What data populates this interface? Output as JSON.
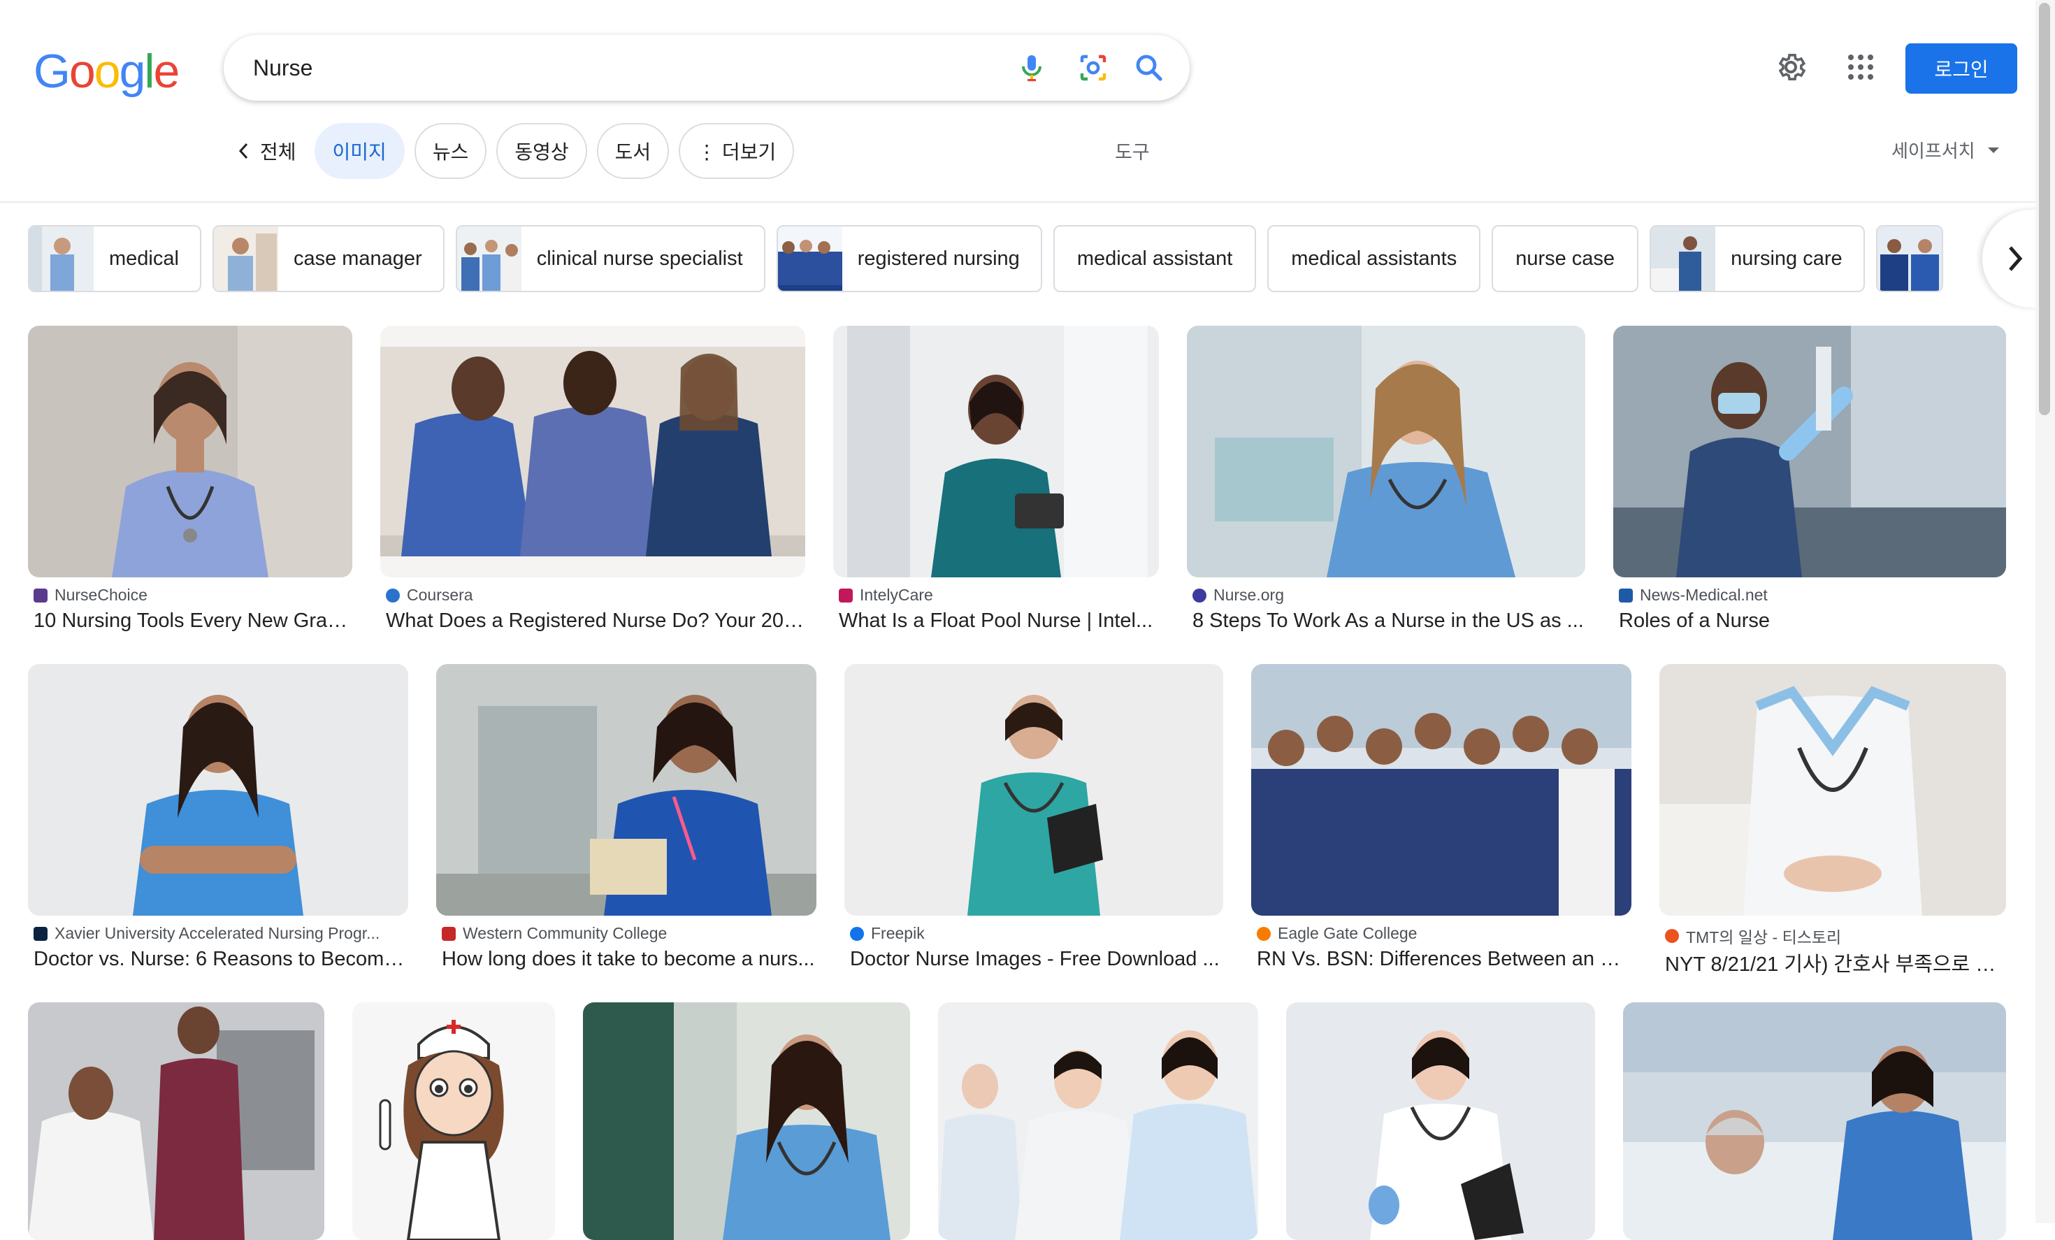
{
  "logo": {
    "letters": [
      "G",
      "o",
      "o",
      "g",
      "l",
      "e"
    ],
    "colors": [
      "#4285F4",
      "#EA4335",
      "#FBBC05",
      "#4285F4",
      "#34A853",
      "#EA4335"
    ]
  },
  "search": {
    "query": "Nurse",
    "icons": [
      "mic-icon",
      "lens-icon",
      "search-icon"
    ]
  },
  "header": {
    "login_label": "로그인",
    "icons": [
      "settings-gear-icon",
      "apps-grid-icon"
    ]
  },
  "tabs": {
    "back_label": "전체",
    "items": [
      {
        "label": "이미지",
        "active": true
      },
      {
        "label": "뉴스"
      },
      {
        "label": "동영상"
      },
      {
        "label": "도서"
      },
      {
        "label": "⋮ 더보기"
      }
    ],
    "tools_label": "도구",
    "safesearch_label": "세이프서치"
  },
  "chips": [
    {
      "label": "medical"
    },
    {
      "label": "case manager"
    },
    {
      "label": "clinical nurse specialist"
    },
    {
      "label": "registered nursing"
    },
    {
      "label": "medical assistant"
    },
    {
      "label": "medical assistants"
    },
    {
      "label": "nurse case"
    },
    {
      "label": "nursing care"
    }
  ],
  "results": [
    {
      "source": "NurseChoice",
      "title": "10 Nursing Tools Every New Grad...",
      "fav": "#5b3b8c"
    },
    {
      "source": "Coursera",
      "title": "What Does a Registered Nurse Do? Your 202...",
      "fav": "#2a73cc"
    },
    {
      "source": "IntelyCare",
      "title": "What Is a Float Pool Nurse | Intel...",
      "fav": "#c2185b"
    },
    {
      "source": "Nurse.org",
      "title": "8 Steps To Work As a Nurse in the US as ...",
      "fav": "#3d3a9e"
    },
    {
      "source": "News-Medical.net",
      "title": "Roles of a Nurse",
      "fav": "#1e5aa8"
    },
    {
      "source": "Xavier University Accelerated Nursing Progr...",
      "title": "Doctor vs. Nurse: 6 Reasons to Become...",
      "fav": "#0c2340"
    },
    {
      "source": "Western Community College",
      "title": "How long does it take to become a nurs...",
      "fav": "#c62828"
    },
    {
      "source": "Freepik",
      "title": "Doctor Nurse Images - Free Download ...",
      "fav": "#1273eb"
    },
    {
      "source": "Eagle Gate College",
      "title": "RN Vs. BSN: Differences Between an R...",
      "fav": "#f57c00"
    },
    {
      "source": "TMT의 일상 - 티스토리",
      "title": "NYT 8/21/21 기사) 간호사 부족으로 위...",
      "fav": "#eb531f"
    }
  ]
}
